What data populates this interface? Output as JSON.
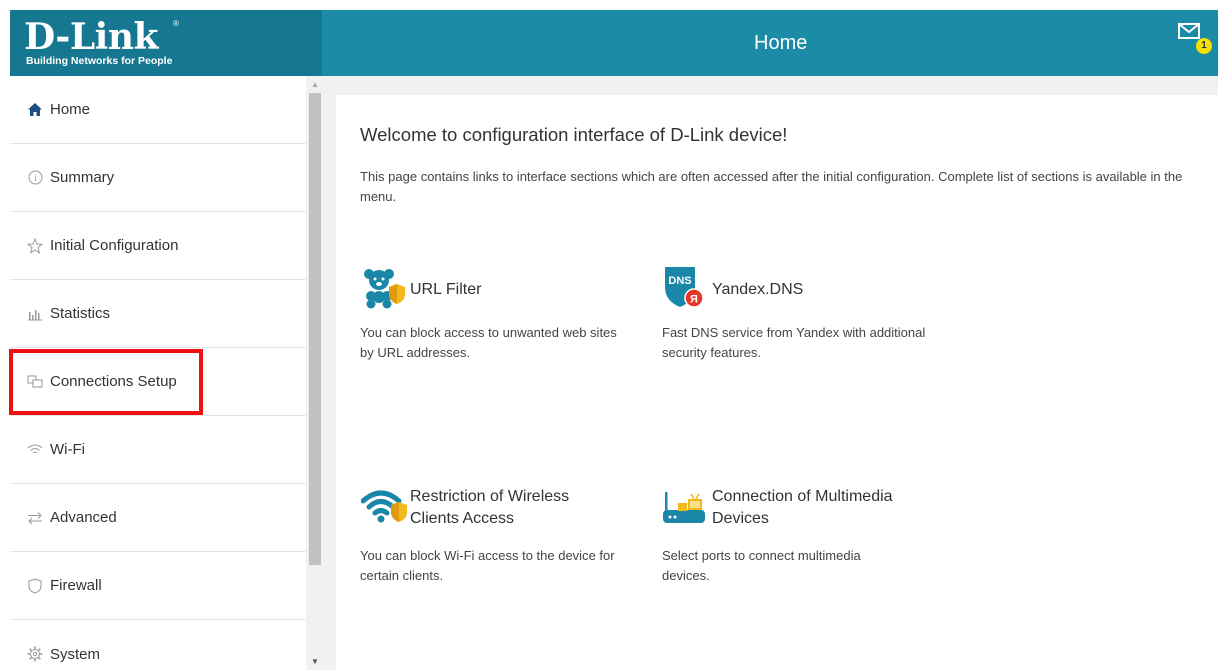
{
  "header": {
    "logo_text": "D-Link",
    "logo_registered": "®",
    "logo_tagline": "Building Networks for People",
    "title": "Home",
    "notifications_count": "1"
  },
  "sidebar": {
    "items": [
      {
        "label": "Home",
        "icon": "home-icon"
      },
      {
        "label": "Summary",
        "icon": "info-icon"
      },
      {
        "label": "Initial Configuration",
        "icon": "star-icon"
      },
      {
        "label": "Statistics",
        "icon": "bar-chart-icon"
      },
      {
        "label": "Connections Setup",
        "icon": "connections-icon"
      },
      {
        "label": "Wi-Fi",
        "icon": "wifi-icon"
      },
      {
        "label": "Advanced",
        "icon": "arrows-icon"
      },
      {
        "label": "Firewall",
        "icon": "shield-icon"
      },
      {
        "label": "System",
        "icon": "gear-icon"
      }
    ],
    "highlighted_item": "Connections Setup"
  },
  "main": {
    "welcome": "Welcome to configuration interface of D-Link device!",
    "intro": "This page contains links to interface sections which are often accessed after the initial configuration. Complete list of sections is available in the menu.",
    "tiles": [
      {
        "title": "URL Filter",
        "desc": "You can block access to unwanted web sites by URL addresses.",
        "icon": "teddy-bear-shield-icon"
      },
      {
        "title": "Yandex.DNS",
        "desc": "Fast DNS service from Yandex with additional security features.",
        "icon": "dns-shield-icon"
      },
      {
        "title": "Restriction of Wireless Clients Access",
        "desc": "You can block Wi-Fi access to the device for certain clients.",
        "icon": "wifi-shield-icon"
      },
      {
        "title": "Connection of Multimedia Devices",
        "desc": "Select ports to connect multimedia devices.",
        "icon": "router-tv-icon"
      }
    ],
    "dns_badge": "DNS",
    "yandex_badge": "Я"
  },
  "colors": {
    "header": "#1b8ba6",
    "logo_bg": "#167790",
    "accent": "#1a86a8",
    "shield": "#f2b91d",
    "highlight": "#ee1111"
  }
}
